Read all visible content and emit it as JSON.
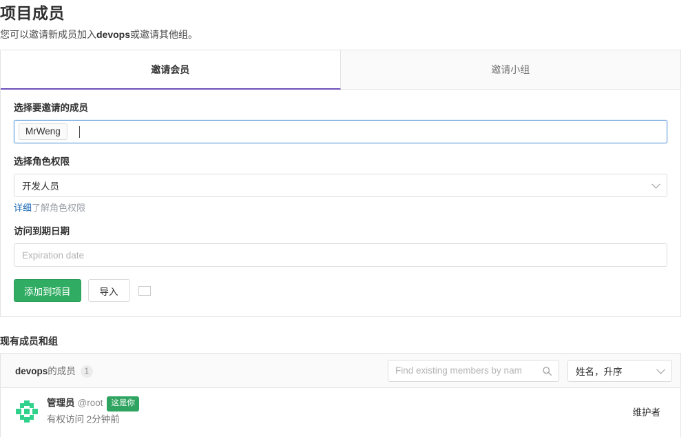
{
  "header": {
    "title": "项目成员",
    "desc_prefix": "您可以邀请新成员加入",
    "desc_bold": "devops",
    "desc_suffix": "或邀请其他组。"
  },
  "tabs": [
    {
      "label": "邀请会员",
      "active": true
    },
    {
      "label": "邀请小组",
      "active": false
    }
  ],
  "form": {
    "member_label": "选择要邀请的成员",
    "member_token": "MrWeng",
    "role_label": "选择角色权限",
    "role_value": "开发人员",
    "role_hint_strong": "详细",
    "role_hint_rest": "了解角色权限",
    "expire_label": "访问到期日期",
    "expire_placeholder": "Expiration date",
    "add_button": "添加到项目",
    "import_button": "导入"
  },
  "existing": {
    "section_title": "现有成员和组",
    "group_name": "devops",
    "group_suffix": "的成员",
    "group_count": "1",
    "search_placeholder": "Find existing members by nam",
    "sort_value": "姓名，升序"
  },
  "members": [
    {
      "name": "管理员",
      "handle": "@root",
      "you_badge": "这是你",
      "access": "有权访问",
      "time": "2分钟前",
      "role": "维护者"
    }
  ],
  "colors": {
    "accent_purple": "#6b4fbb",
    "green": "#31ad63",
    "badge_green": "#2fa360",
    "link_blue": "#1b69b6",
    "focus_blue": "#5b9ad8"
  },
  "icons": {
    "search": "search-icon",
    "chevron": "chevron-down-icon",
    "avatar": "identicon-avatar"
  }
}
